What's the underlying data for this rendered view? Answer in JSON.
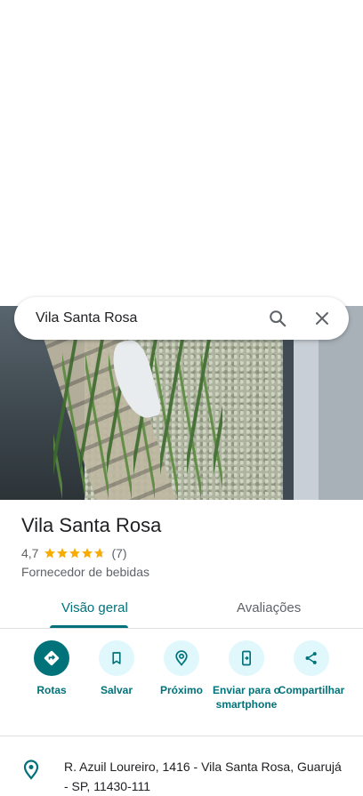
{
  "search": {
    "query": "Vila Santa Rosa"
  },
  "place": {
    "name": "Vila Santa Rosa",
    "rating": "4,7",
    "stars": 4.7,
    "review_count": "(7)",
    "category": "Fornecedor de bebidas"
  },
  "tabs": [
    {
      "label": "Visão geral"
    },
    {
      "label": "Avaliações"
    }
  ],
  "actions": [
    {
      "label": "Rotas",
      "icon": "directions-icon"
    },
    {
      "label": "Salvar",
      "icon": "bookmark-icon"
    },
    {
      "label": "Próximo",
      "icon": "nearby-icon"
    },
    {
      "label": "Enviar para o smartphone",
      "icon": "send-to-phone-icon"
    },
    {
      "label": "Compartilhar",
      "icon": "share-icon"
    }
  ],
  "address": {
    "text": "R. Azuil Loureiro, 1416 - Vila Santa Rosa, Guarujá - SP, 11430-111"
  },
  "colors": {
    "accent": "#00727a",
    "star": "#f9ab00",
    "action_bg": "#e0f7fb"
  }
}
